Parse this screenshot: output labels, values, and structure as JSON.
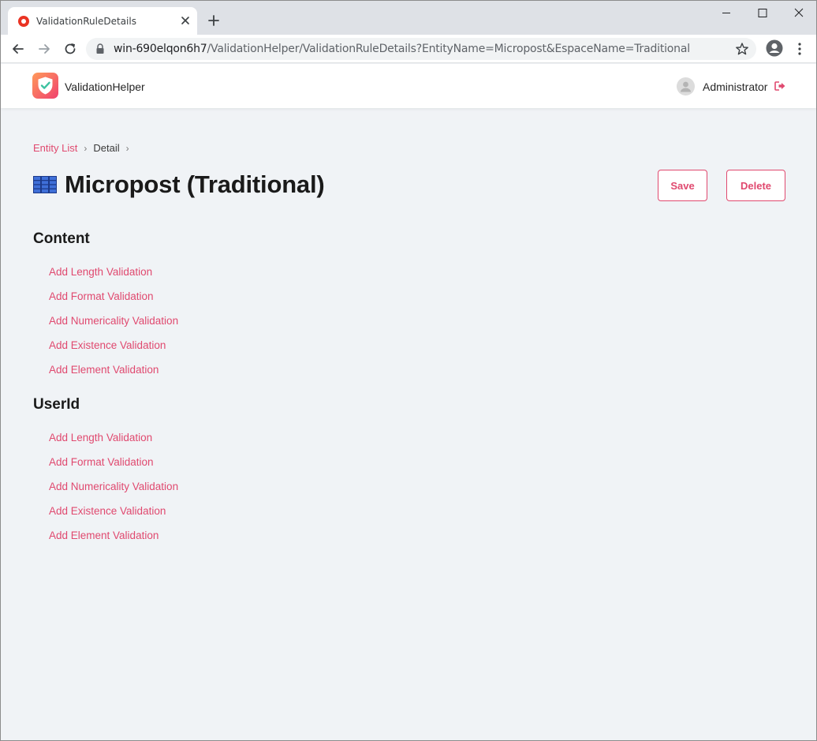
{
  "browser": {
    "tab_title": "ValidationRuleDetails",
    "url_host": "win-690elqon6h7",
    "url_path": "/ValidationHelper/ValidationRuleDetails?EntityName=Micropost&EspaceName=Traditional"
  },
  "header": {
    "app_name": "ValidationHelper",
    "user_name": "Administrator"
  },
  "breadcrumb": {
    "link": "Entity List",
    "separator": "›",
    "current": "Detail"
  },
  "page": {
    "title": "Micropost (Traditional)",
    "save_label": "Save",
    "delete_label": "Delete"
  },
  "sections": [
    {
      "title": "Content",
      "links": [
        "Add Length Validation",
        "Add Format Validation",
        "Add Numericality Validation",
        "Add Existence Validation",
        "Add Element Validation"
      ]
    },
    {
      "title": "UserId",
      "links": [
        "Add Length Validation",
        "Add Format Validation",
        "Add Numericality Validation",
        "Add Existence Validation",
        "Add Element Validation"
      ]
    }
  ],
  "colors": {
    "accent": "#e0496f",
    "background": "#f0f3f6",
    "tabstrip": "#dee1e6"
  },
  "icons": {
    "favicon": "recording-dot-icon",
    "logo": "shield-check-icon",
    "title": "table-grid-icon",
    "logout": "logout-icon"
  }
}
